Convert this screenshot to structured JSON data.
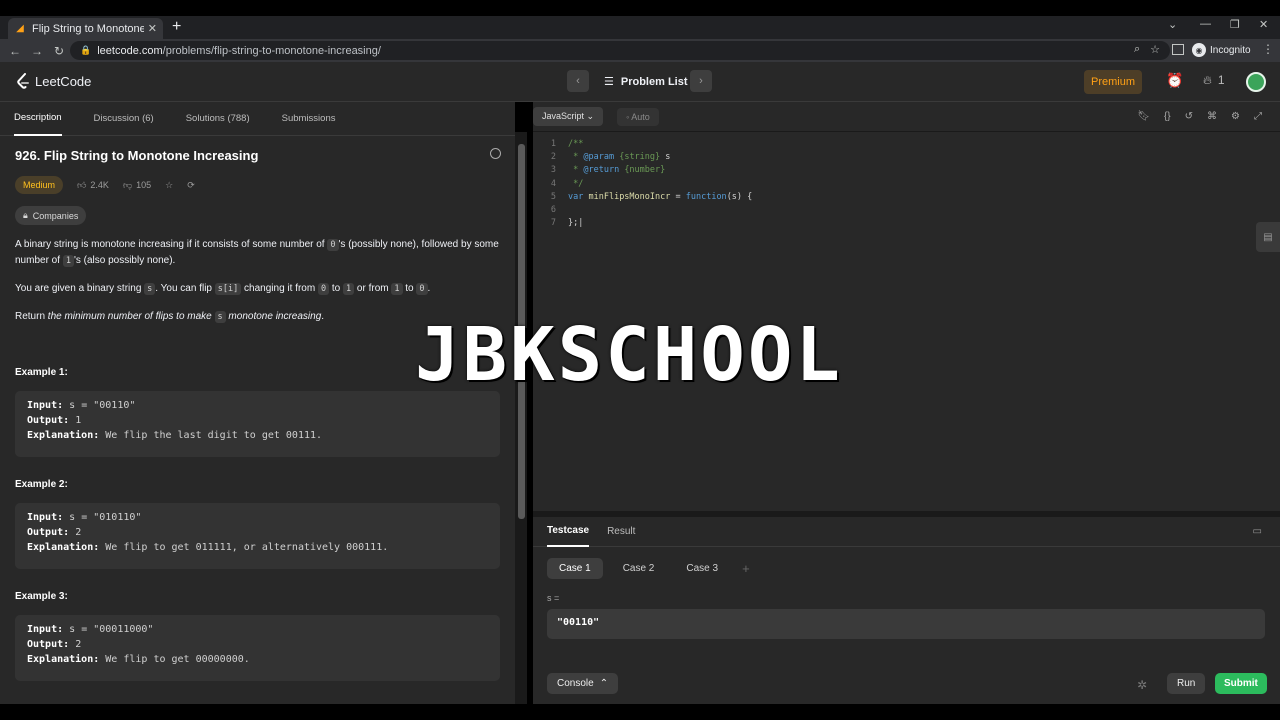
{
  "browser": {
    "tab_title": "Flip String to Monotone Increasing",
    "url_domain": "leetcode.com",
    "url_path": "/problems/flip-string-to-monotone-increasing/",
    "incognito_label": "Incognito"
  },
  "header": {
    "logo_text": "LeetCode",
    "problem_list_label": "Problem List",
    "premium_label": "Premium",
    "streak_count": "1"
  },
  "left_tabs": [
    "Description",
    "Discussion (6)",
    "Solutions (788)",
    "Submissions"
  ],
  "problem": {
    "title": "926. Flip String to Monotone Increasing",
    "difficulty": "Medium",
    "likes": "2.4K",
    "dislikes": "105",
    "companies_label": "Companies",
    "p1_a": "A binary string is monotone increasing if it consists of some number of ",
    "p1_code1": "0",
    "p1_b": "'s (possibly none), followed by some number of ",
    "p1_code2": "1",
    "p1_c": "'s (also possibly none).",
    "p2_a": "You are given a binary string ",
    "p2_code1": "s",
    "p2_b": ". You can flip ",
    "p2_code2": "s[i]",
    "p2_c": " changing it from ",
    "p2_code3": "0",
    "p2_d": " to ",
    "p2_code4": "1",
    "p2_e": " or from ",
    "p2_code5": "1",
    "p2_f": " to ",
    "p2_code6": "0",
    "p2_g": ".",
    "p3_a": "Return ",
    "p3_em1": "the minimum number of flips to make ",
    "p3_code": "s",
    "p3_em2": " monotone increasing",
    "p3_b": ".",
    "examples": [
      {
        "title": "Example 1:",
        "input": "s = \"00110\"",
        "output": "1",
        "explanation": "We flip the last digit to get 00111."
      },
      {
        "title": "Example 2:",
        "input": "s = \"010110\"",
        "output": "2",
        "explanation": "We flip to get 011111, or alternatively 000111."
      },
      {
        "title": "Example 3:",
        "input": "s = \"00011000\"",
        "output": "2",
        "explanation": "We flip to get 00000000."
      }
    ],
    "label_input": "Input:",
    "label_output": "Output:",
    "label_explanation": "Explanation:"
  },
  "editor": {
    "language": "JavaScript",
    "mode": "Auto",
    "lines": [
      "1",
      "2",
      "3",
      "4",
      "5",
      "6",
      "7"
    ]
  },
  "watermark": "JBKSCHOOL",
  "testcase": {
    "tabs": [
      "Testcase",
      "Result"
    ],
    "cases": [
      "Case 1",
      "Case 2",
      "Case 3"
    ],
    "var_label": "s =",
    "value": "\"00110\"",
    "console_label": "Console",
    "run_label": "Run",
    "submit_label": "Submit"
  },
  "colors": {
    "accent": "#ffa116",
    "submit": "#2cbb5d",
    "medium": "#ffc01e"
  }
}
